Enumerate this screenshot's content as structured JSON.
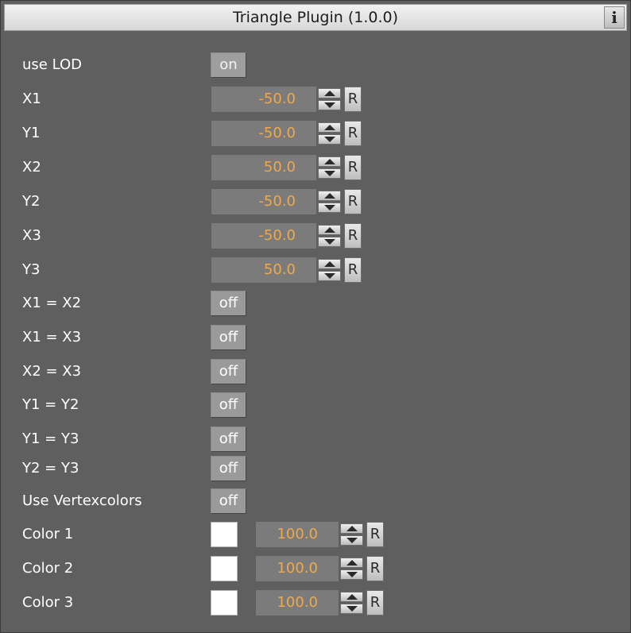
{
  "window": {
    "title": "Triangle Plugin (1.0.0)",
    "info_glyph": "i"
  },
  "rows": [
    {
      "label": "use LOD",
      "type": "toggle",
      "value": "on"
    },
    {
      "label": "X1",
      "type": "number",
      "value": "-50.0"
    },
    {
      "label": "Y1",
      "type": "number",
      "value": "-50.0"
    },
    {
      "label": "X2",
      "type": "number",
      "value": "50.0"
    },
    {
      "label": "Y2",
      "type": "number",
      "value": "-50.0"
    },
    {
      "label": "X3",
      "type": "number",
      "value": "-50.0"
    },
    {
      "label": "Y3",
      "type": "number",
      "value": "50.0"
    },
    {
      "label": "X1 = X2",
      "type": "toggle",
      "value": "off"
    },
    {
      "label": "X1 = X3",
      "type": "toggle",
      "value": "off"
    },
    {
      "label": "X2 = X3",
      "type": "toggle",
      "value": "off"
    },
    {
      "label": "Y1 = Y2",
      "type": "toggle",
      "value": "off"
    },
    {
      "label": "Y1 = Y3",
      "type": "toggle",
      "value": "off"
    },
    {
      "label": "Y2 = Y3",
      "type": "toggle",
      "value": "off"
    },
    {
      "label": "Use Vertexcolors",
      "type": "toggle",
      "value": "off"
    },
    {
      "label": "Color 1",
      "type": "color",
      "color": "#ffffff",
      "value": "100.0"
    },
    {
      "label": "Color 2",
      "type": "color",
      "color": "#ffffff",
      "value": "100.0"
    },
    {
      "label": "Color 3",
      "type": "color",
      "color": "#ffffff",
      "value": "100.0"
    }
  ],
  "reset_label": "R",
  "colors": {
    "panel_bg": "#5f5f5f",
    "value_text": "#f0a94a",
    "field_bg": "#7b7b7b"
  }
}
